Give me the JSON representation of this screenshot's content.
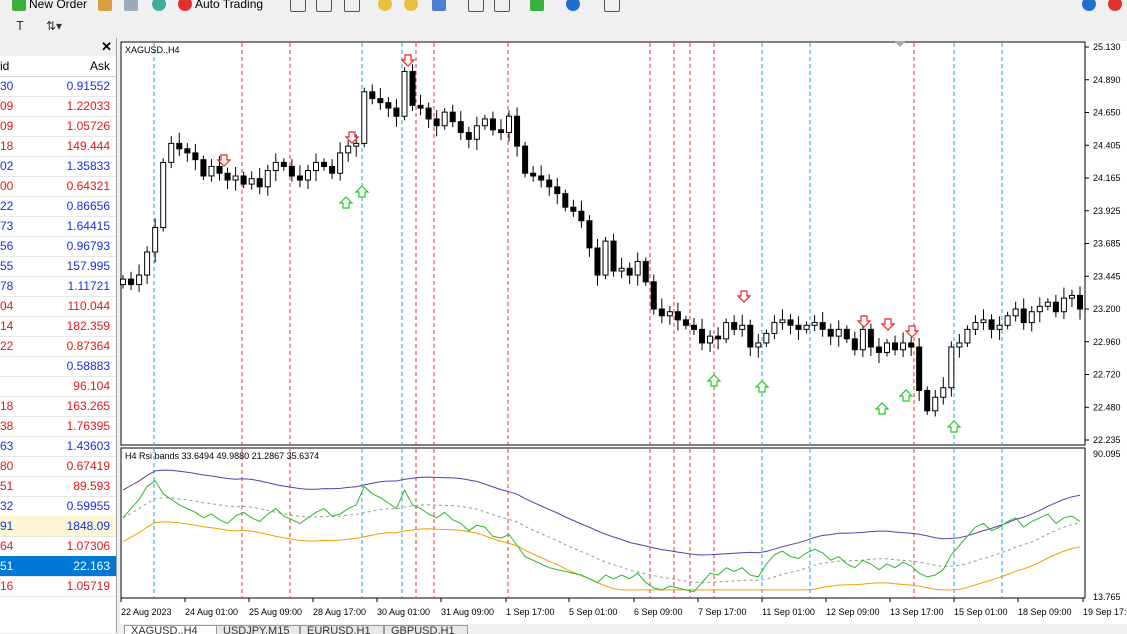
{
  "toolbar": {
    "new_order": "New Order",
    "auto_trading": "Auto Trading"
  },
  "market_watch": {
    "columns": {
      "bid": "id",
      "ask": "Ask"
    },
    "rows": [
      {
        "bid": "30",
        "ask": "0.91552",
        "color": "blue"
      },
      {
        "bid": "09",
        "ask": "1.22033",
        "color": "red"
      },
      {
        "bid": "09",
        "ask": "1.05726",
        "color": "red"
      },
      {
        "bid": "18",
        "ask": "149.444",
        "color": "red"
      },
      {
        "bid": "02",
        "ask": "1.35833",
        "color": "blue"
      },
      {
        "bid": "00",
        "ask": "0.64321",
        "color": "red"
      },
      {
        "bid": "22",
        "ask": "0.86656",
        "color": "blue"
      },
      {
        "bid": "73",
        "ask": "1.64415",
        "color": "blue"
      },
      {
        "bid": "56",
        "ask": "0.96793",
        "color": "blue"
      },
      {
        "bid": "55",
        "ask": "157.995",
        "color": "blue"
      },
      {
        "bid": "78",
        "ask": "1.11721",
        "color": "blue"
      },
      {
        "bid": "04",
        "ask": "110.044",
        "color": "red"
      },
      {
        "bid": "14",
        "ask": "182.359",
        "color": "red"
      },
      {
        "bid": "22",
        "ask": "0.87364",
        "color": "red"
      },
      {
        "bid": "",
        "ask": "0.58883",
        "color": "blue"
      },
      {
        "bid": "",
        "ask": "96.104",
        "color": "red"
      },
      {
        "bid": "18",
        "ask": "163.265",
        "color": "red"
      },
      {
        "bid": "38",
        "ask": "1.76395",
        "color": "red"
      },
      {
        "bid": "63",
        "ask": "1.43603",
        "color": "blue"
      },
      {
        "bid": "80",
        "ask": "0.67419",
        "color": "red"
      },
      {
        "bid": "51",
        "ask": "89.593",
        "color": "red"
      },
      {
        "bid": "32",
        "ask": "0.59955",
        "color": "blue"
      },
      {
        "bid": "91",
        "ask": "1848.09",
        "color": "blue",
        "style": "hl"
      },
      {
        "bid": "64",
        "ask": "1.07306",
        "color": "red"
      },
      {
        "bid": "51",
        "ask": "22.163",
        "color": "white",
        "style": "sel"
      },
      {
        "bid": "16",
        "ask": "1.05719",
        "color": "red"
      }
    ]
  },
  "chart": {
    "symbol_label": "XAGUSD.,H4",
    "indicator_label": "H4 Rsi bands 33.6494 49.9880 21.2867 35.6374",
    "price_axis": [
      "25.130",
      "24.890",
      "24.650",
      "24.405",
      "24.165",
      "23.925",
      "23.685",
      "23.445",
      "23.200",
      "22.960",
      "22.720",
      "22.480",
      "22.235"
    ],
    "indicator_axis": [
      "90.095",
      "13.765"
    ],
    "time_axis": [
      "22 Aug 2023",
      "24 Aug 01:00",
      "25 Aug 09:00",
      "28 Aug 17:00",
      "30 Aug 01:00",
      "31 Aug 09:00",
      "1 Sep 17:00",
      "5 Sep 01:00",
      "6 Sep 09:00",
      "7 Sep 17:00",
      "11 Sep 01:00",
      "12 Sep 09:00",
      "13 Sep 17:00",
      "15 Sep 01:00",
      "18 Sep 09:00",
      "19 Sep 17:0"
    ],
    "colors": {
      "bull": "#ffffff",
      "bear": "#000000",
      "up_arrow": "#22cc22",
      "down_arrow": "#ee2222",
      "vline_blue": "#1a9fe0",
      "vline_red": "#e03030",
      "rsi": "#2db52d",
      "upper_band": "#5c3fa8",
      "mid_band": "#999999",
      "lower_band": "#f0a000"
    }
  },
  "chart_data": {
    "type": "candlestick",
    "symbol": "XAGUSD",
    "timeframe": "H4",
    "ylim": [
      22.235,
      25.13
    ],
    "indicator_ylim": [
      13.765,
      90.095
    ],
    "close_series": [
      23.42,
      23.38,
      23.45,
      23.62,
      23.8,
      24.28,
      24.42,
      24.38,
      24.35,
      24.3,
      24.18,
      24.25,
      24.2,
      24.15,
      24.18,
      24.12,
      24.16,
      24.1,
      24.22,
      24.28,
      24.25,
      24.18,
      24.15,
      24.22,
      24.28,
      24.25,
      24.2,
      24.35,
      24.4,
      24.42,
      24.8,
      24.75,
      24.72,
      24.68,
      24.62,
      24.95,
      24.7,
      24.68,
      24.6,
      24.55,
      24.65,
      24.58,
      24.5,
      24.45,
      24.55,
      24.6,
      24.52,
      24.5,
      24.62,
      24.4,
      24.2,
      24.18,
      24.15,
      24.1,
      24.05,
      23.95,
      23.92,
      23.85,
      23.65,
      23.45,
      23.7,
      23.48,
      23.5,
      23.45,
      23.55,
      23.4,
      23.2,
      23.15,
      23.18,
      23.12,
      23.08,
      23.05,
      22.95,
      23.0,
      22.98,
      23.1,
      23.05,
      23.08,
      22.92,
      22.95,
      23.02,
      23.1,
      23.12,
      23.08,
      23.05,
      23.08,
      23.1,
      23.05,
      23.0,
      23.05,
      22.98,
      22.9,
      23.05,
      22.92,
      22.88,
      22.95,
      22.9,
      22.95,
      22.92,
      22.6,
      22.45,
      22.55,
      22.62,
      22.92,
      22.95,
      23.05,
      23.1,
      23.12,
      23.05,
      23.08,
      23.15,
      23.2,
      23.1,
      23.18,
      23.22,
      23.25,
      23.18,
      23.28,
      23.3,
      23.2
    ],
    "rsi": [
      55,
      60,
      65,
      72,
      75,
      68,
      65,
      62,
      60,
      58,
      55,
      57,
      54,
      52,
      56,
      58,
      55,
      53,
      57,
      60,
      56,
      54,
      52,
      55,
      58,
      60,
      56,
      57,
      60,
      62,
      72,
      68,
      66,
      63,
      60,
      70,
      62,
      60,
      57,
      55,
      58,
      54,
      52,
      48,
      51,
      50,
      45,
      44,
      46,
      40,
      34,
      32,
      30,
      28,
      27,
      26,
      25,
      24,
      22,
      20,
      24,
      22,
      24,
      22,
      25,
      20,
      17,
      16,
      18,
      17,
      16,
      15,
      20,
      25,
      24,
      28,
      26,
      28,
      24,
      23,
      30,
      35,
      37,
      34,
      33,
      36,
      38,
      36,
      32,
      34,
      30,
      28,
      32,
      30,
      27,
      30,
      28,
      31,
      29,
      25,
      23,
      24,
      27,
      35,
      40,
      45,
      50,
      52,
      48,
      50,
      53,
      55,
      50,
      53,
      55,
      57,
      52,
      55,
      56,
      53
    ]
  }
}
